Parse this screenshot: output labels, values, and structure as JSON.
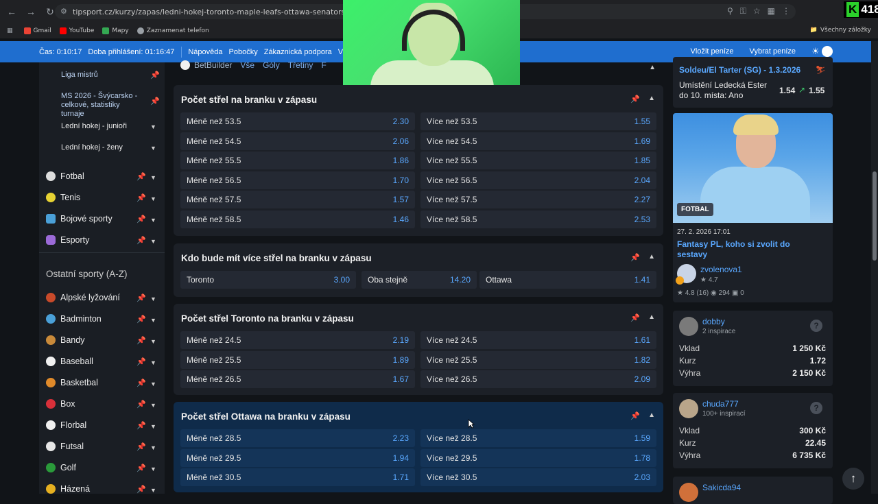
{
  "browser": {
    "url": "tipsport.cz/kurzy/zapas/ledni-hokej-toronto-maple-leafs-ottawa-senators/7436810/co-se-sazi",
    "bookmarks": [
      "Gmail",
      "YouTube",
      "Mapy",
      "Zaznamenat telefon"
    ],
    "all_bookmarks": "Všechny záložky"
  },
  "stream_badge": {
    "letter": "K",
    "count": "418"
  },
  "topbar": {
    "time": "Čas: 0:10:17",
    "login": "Doba přihlášení: 01:16:47",
    "links": [
      "Nápověda",
      "Pobočky",
      "Zákaznická podpora",
      "Vylou"
    ],
    "deposit": "Vložit peníze",
    "withdraw": "Vybrat peníze"
  },
  "sidebar": {
    "subitems": [
      "Liga mistrů",
      "MS 2026 - Švýcarsko - celkové, statistiky turnaje",
      "Lední hokej - junioři",
      "Lední hokej - ženy"
    ],
    "favorites": [
      "Fotbal",
      "Tenis",
      "Bojové sporty",
      "Esporty"
    ],
    "other_heading": "Ostatní sporty (A-Z)",
    "others": [
      "Alpské lyžování",
      "Badminton",
      "Bandy",
      "Baseball",
      "Basketbal",
      "Box",
      "Florbal",
      "Futsal",
      "Golf",
      "Házená"
    ]
  },
  "filters": {
    "betbuilder": "BetBuilder",
    "tabs": [
      "Vše",
      "Góly",
      "Třetiny",
      "F"
    ]
  },
  "markets": [
    {
      "title": "Počet střel na branku v zápasu",
      "rows": [
        [
          "Méně než 53.5",
          "2.30",
          "Více než 53.5",
          "1.55"
        ],
        [
          "Méně než 54.5",
          "2.06",
          "Více než 54.5",
          "1.69"
        ],
        [
          "Méně než 55.5",
          "1.86",
          "Více než 55.5",
          "1.85"
        ],
        [
          "Méně než 56.5",
          "1.70",
          "Více než 56.5",
          "2.04"
        ],
        [
          "Méně než 57.5",
          "1.57",
          "Více než 57.5",
          "2.27"
        ],
        [
          "Méně než 58.5",
          "1.46",
          "Více než 58.5",
          "2.53"
        ]
      ]
    },
    {
      "title": "Kdo bude mít více střel na branku v zápasu",
      "rows": [
        [
          "Toronto",
          "3.00",
          "Oba stejně",
          "14.20",
          "Ottawa",
          "1.41"
        ]
      ]
    },
    {
      "title": "Počet střel Toronto na branku v zápasu",
      "rows": [
        [
          "Méně než 24.5",
          "2.19",
          "Více než 24.5",
          "1.61"
        ],
        [
          "Méně než 25.5",
          "1.89",
          "Více než 25.5",
          "1.82"
        ],
        [
          "Méně než 26.5",
          "1.67",
          "Více než 26.5",
          "2.09"
        ]
      ]
    },
    {
      "title": "Počet střel Ottawa na branku v zápasu",
      "rows": [
        [
          "Méně než 28.5",
          "2.23",
          "Více než 28.5",
          "1.59"
        ],
        [
          "Méně než 29.5",
          "1.94",
          "Více než 29.5",
          "1.78"
        ],
        [
          "Méně než 30.5",
          "1.71",
          "Více než 30.5",
          "2.03"
        ]
      ]
    }
  ],
  "right": {
    "event_title": "Soldeu/El Tarter (SG) - 1.3.2026",
    "event_bet": "Umístění Ledecká Ester do 10. místa: Ano",
    "event_odd_old": "1.54",
    "event_odd_new": "1.55",
    "news_tag": "FOTBAL",
    "news_date": "27. 2. 2026 17:01",
    "news_title": "Fantasy PL, koho si zvolit do sestavy",
    "author": "zvolenova1",
    "author_rating": "4.7",
    "stats": {
      "rating": "4.8 (16)",
      "views": "294",
      "comments": "0"
    },
    "tipsters": [
      {
        "name": "dobby",
        "sub": "2 inspirace",
        "vklad": "1 250 Kč",
        "kurz": "1.72",
        "vyhra": "2 150 Kč"
      },
      {
        "name": "chuda777",
        "sub": "100+ inspirací",
        "vklad": "300 Kč",
        "kurz": "22.45",
        "vyhra": "6 735 Kč"
      },
      {
        "name": "Sakicda94"
      }
    ],
    "labels": {
      "vklad": "Vklad",
      "kurz": "Kurz",
      "vyhra": "Výhra"
    }
  }
}
